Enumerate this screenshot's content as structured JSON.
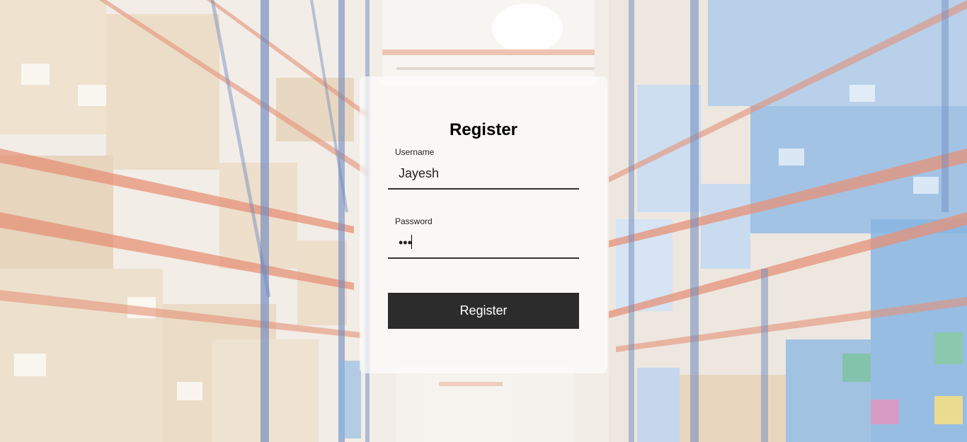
{
  "form": {
    "title": "Register",
    "username_label": "Username",
    "username_value": "Jayesh",
    "password_label": "Password",
    "password_value": "abc",
    "submit_label": "Register"
  },
  "colors": {
    "button_bg": "#2c2c2c",
    "button_text": "#ffffff",
    "input_underline": "#333333",
    "shelf_orange": "#e0795a",
    "shelf_blue": "#4f6fb0",
    "box_tan": "#ecdcc4",
    "bin_blue": "#6fa6dc"
  },
  "background": {
    "scene": "warehouse-aisle"
  }
}
